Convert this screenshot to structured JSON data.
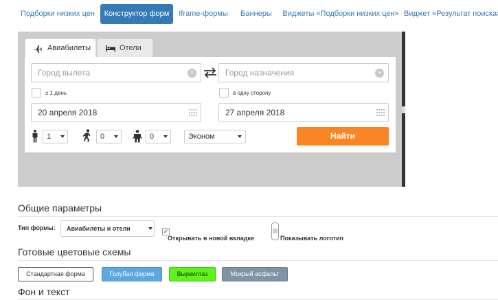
{
  "nav": {
    "items": [
      {
        "label": "Подборки низких цен",
        "active": false
      },
      {
        "label": "Конструктор форм",
        "active": true
      },
      {
        "label": "Iframe-формы",
        "active": false
      },
      {
        "label": "Баннеры",
        "active": false
      },
      {
        "label": "Виджеты «Подборки низких цен»",
        "active": false
      },
      {
        "label": "Виджет «Результат поиска»",
        "active": false
      }
    ]
  },
  "preview": {
    "tabs": [
      {
        "label": "Авиабилеты",
        "icon": "plane-icon",
        "active": true
      },
      {
        "label": "Отели",
        "icon": "bed-icon",
        "active": false
      }
    ],
    "origin": {
      "placeholder": "Город вылета",
      "value": ""
    },
    "destination": {
      "placeholder": "Город назначения",
      "value": ""
    },
    "flexible_dates_label": "± 1 день",
    "one_way_label": "в одну сторону",
    "depart_date": "20 апреля 2018",
    "return_date": "27 апреля 2018",
    "adults": "1",
    "children": "0",
    "infants": "0",
    "cabin_class": "Эконом",
    "search_button": "Найти"
  },
  "settings": {
    "general_title": "Общие параметры",
    "form_type_label": "Тип формы:",
    "form_type_value": "Авиабилеты и отели",
    "open_new_tab_label": "Открывать в новой вкладке",
    "open_new_tab_checked": true,
    "show_logo_label": "Показывать логотип",
    "show_logo_checked": false,
    "color_schemes_title": "Готовые цветовые схемы",
    "color_schemes": [
      {
        "label": "Стандартная форма",
        "color": "#ffffff"
      },
      {
        "label": "Голубая форма",
        "color": "#5ea7df"
      },
      {
        "label": "Вырвиглаз",
        "color": "#5ef41b"
      },
      {
        "label": "Мокрый асфальт",
        "color": "#8393a6"
      }
    ],
    "background_text_title": "Фон и текст"
  },
  "colors": {
    "accent": "#337ab7",
    "search_button": "#fa8623",
    "preview_background": "#cccccc"
  }
}
